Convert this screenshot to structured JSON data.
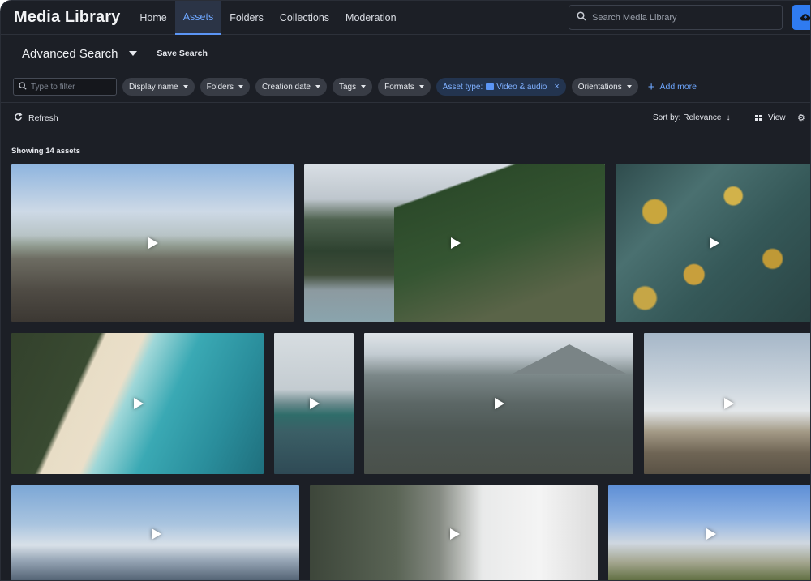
{
  "app": {
    "title": "Media Library"
  },
  "nav": {
    "tabs": [
      {
        "label": "Home",
        "active": false
      },
      {
        "label": "Assets",
        "active": true
      },
      {
        "label": "Folders",
        "active": false
      },
      {
        "label": "Collections",
        "active": false
      },
      {
        "label": "Moderation",
        "active": false
      }
    ]
  },
  "search": {
    "placeholder": "Search Media Library",
    "icon": "search-icon"
  },
  "upload": {
    "icon": "cloud-upload-icon"
  },
  "advanced": {
    "title": "Advanced Search",
    "save_label": "Save Search"
  },
  "filters": {
    "input_placeholder": "Type to filter",
    "chips": [
      {
        "label": "Display name"
      },
      {
        "label": "Folders"
      },
      {
        "label": "Creation date"
      },
      {
        "label": "Tags"
      },
      {
        "label": "Formats"
      }
    ],
    "active_chip": {
      "key": "Asset type:",
      "value": "Video & audio",
      "remove": "×"
    },
    "orientations": "Orientations",
    "add_more": "Add more"
  },
  "toolbar": {
    "refresh": "Refresh",
    "sort": "Sort by: Relevance",
    "sort_arrow": "↓",
    "view": "View",
    "settings": "S"
  },
  "results": {
    "showing": "Showing 14 assets"
  },
  "assets": [
    {
      "type": "video",
      "scene": "horseback riders on beach"
    },
    {
      "type": "video",
      "scene": "mountain road along lake"
    },
    {
      "type": "video",
      "scene": "aerial forest autumn"
    },
    {
      "type": "video",
      "scene": "aerial beach turquoise water"
    },
    {
      "type": "video",
      "scene": "ocean wave"
    },
    {
      "type": "video",
      "scene": "volcano landscape"
    },
    {
      "type": "video",
      "scene": "geothermal steam field"
    },
    {
      "type": "video",
      "scene": "snowy mountain range"
    },
    {
      "type": "video",
      "scene": "suspension bridge and sacks"
    },
    {
      "type": "video",
      "scene": "alpine meadow"
    }
  ],
  "colors": {
    "accent": "#5b95f5",
    "background": "#1c1f26"
  }
}
